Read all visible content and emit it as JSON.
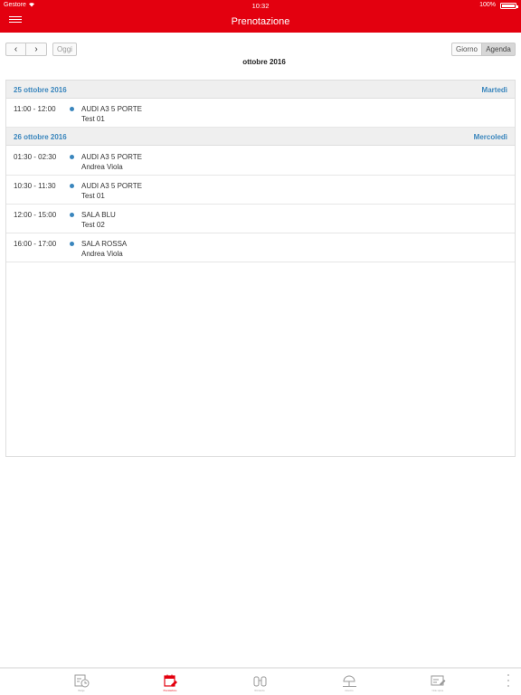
{
  "status_bar": {
    "carrier": "Gestore",
    "time": "10:32",
    "battery": "100%"
  },
  "header": {
    "title": "Prenotazione"
  },
  "toolbar": {
    "today_label": "Oggi",
    "day_label": "Giorno",
    "agenda_label": "Agenda",
    "prev_icon": "chevron-left-icon",
    "next_icon": "chevron-right-icon",
    "active_view": "Agenda"
  },
  "month_label": "ottobre 2016",
  "days": [
    {
      "date": "25 ottobre 2016",
      "weekday": "Martedì",
      "events": [
        {
          "time": "11:00 - 12:00",
          "resource": "AUDI A3 5 PORTE",
          "person": "Test 01"
        }
      ]
    },
    {
      "date": "26 ottobre 2016",
      "weekday": "Mercoledì",
      "events": [
        {
          "time": "01:30 - 02:30",
          "resource": "AUDI A3 5 PORTE",
          "person": "Andrea Viola"
        },
        {
          "time": "10:30 - 11:30",
          "resource": "AUDI A3 5 PORTE",
          "person": "Test 01"
        },
        {
          "time": "12:00 - 15:00",
          "resource": "SALA BLU",
          "person": "Test 02"
        },
        {
          "time": "16:00 - 17:00",
          "resource": "SALA ROSSA",
          "person": "Andrea Viola"
        }
      ]
    }
  ],
  "colors": {
    "brand": "#e3000f",
    "accent": "#3a86bd"
  },
  "tabs": [
    {
      "icon": "time-card-icon",
      "label": "Badge",
      "active": false
    },
    {
      "icon": "calendar-edit-icon",
      "label": "Prenotazione",
      "active": true
    },
    {
      "icon": "binoculars-icon",
      "label": "Rintraccia",
      "active": false
    },
    {
      "icon": "beach-umbrella-icon",
      "label": "Assenze",
      "active": false
    },
    {
      "icon": "document-edit-icon",
      "label": "Note spese",
      "active": false
    }
  ]
}
